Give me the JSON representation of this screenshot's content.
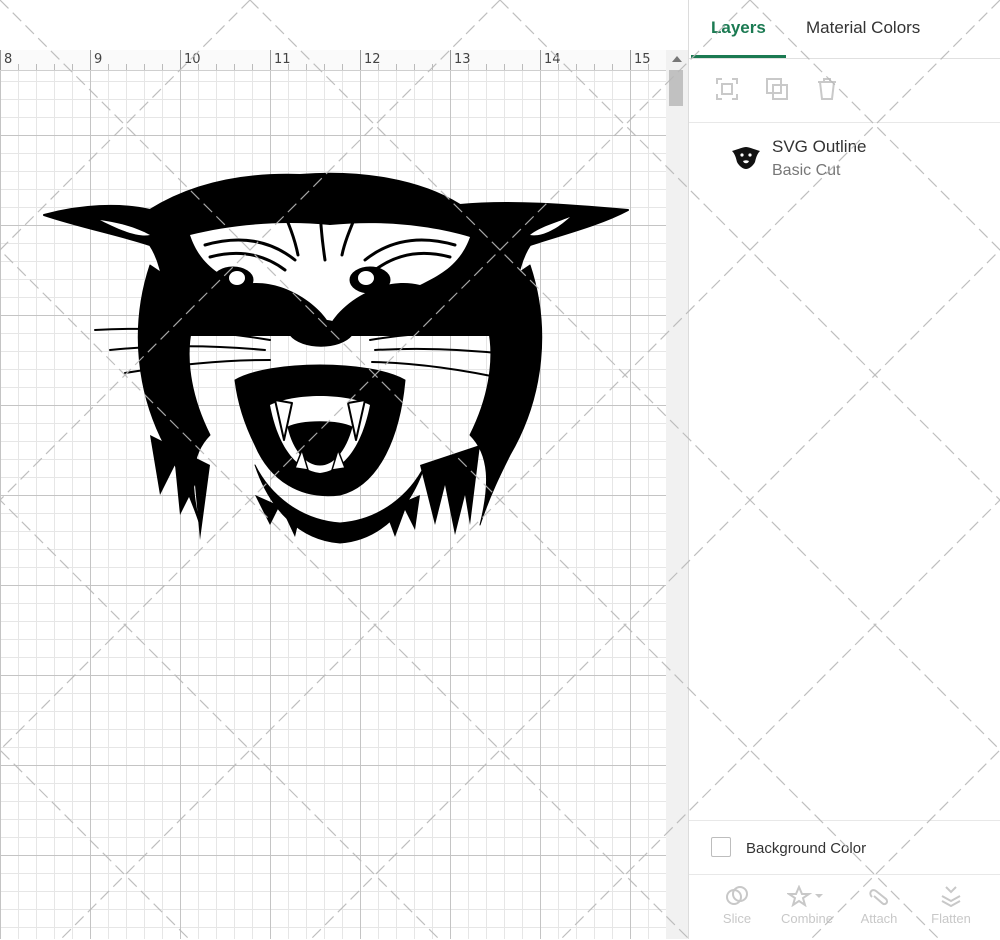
{
  "ruler": {
    "labels": [
      "8",
      "9",
      "10",
      "11",
      "12",
      "13",
      "14",
      "15"
    ]
  },
  "canvas": {
    "design_name": "SVG Outline"
  },
  "panel": {
    "tabs": [
      {
        "label": "Layers",
        "active": true
      },
      {
        "label": "Material Colors",
        "active": false
      }
    ],
    "toolbar": [
      {
        "icon": "group-icon",
        "enabled": false
      },
      {
        "icon": "duplicate-icon",
        "enabled": false
      },
      {
        "icon": "trash-icon",
        "enabled": false
      }
    ],
    "layers": [
      {
        "name": "SVG Outline",
        "operation": "Basic Cut",
        "thumbnail_icon": "wildcat-thumbnail-icon"
      }
    ],
    "background": {
      "label": "Background Color",
      "checked": false
    },
    "bottom_tools": [
      {
        "label": "Slice",
        "icon": "slice-icon"
      },
      {
        "label": "Combine",
        "icon": "combine-icon"
      },
      {
        "label": "Attach",
        "icon": "attach-icon"
      },
      {
        "label": "Flatten",
        "icon": "flatten-icon"
      }
    ]
  },
  "colors": {
    "accent": "#1b7a52",
    "design_fill": "#000000",
    "grid_major": "#c4c4c4",
    "grid_minor": "#e6e6e6"
  }
}
